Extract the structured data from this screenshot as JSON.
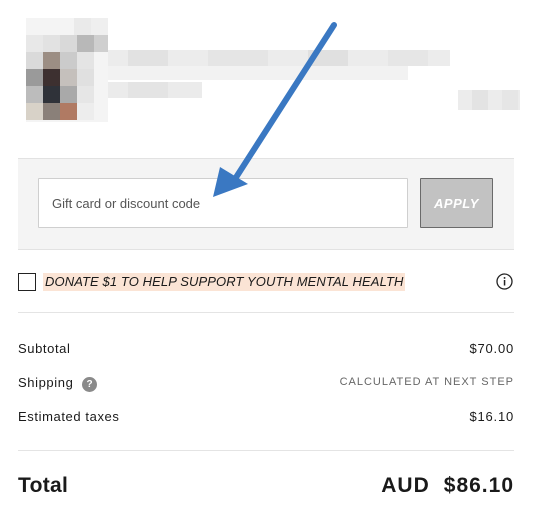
{
  "discount": {
    "placeholder": "Gift card or discount code",
    "apply_label": "APPLY"
  },
  "donate": {
    "label": "DONATE $1 TO HELP SUPPORT YOUTH MENTAL HEALTH",
    "checked": false
  },
  "summary": {
    "subtotal_label": "Subtotal",
    "subtotal_value": "$70.00",
    "shipping_label": "Shipping",
    "shipping_help": "?",
    "shipping_value": "CALCULATED AT NEXT STEP",
    "taxes_label": "Estimated taxes",
    "taxes_value": "$16.10"
  },
  "total": {
    "label": "Total",
    "currency": "AUD",
    "amount": "$86.10"
  },
  "colors": {
    "donate_highlight": "#fbe4d5",
    "apply_bg": "#c2c2c2",
    "annotation_arrow": "#3a78c2",
    "discount_band_bg": "#f4f4f4"
  }
}
